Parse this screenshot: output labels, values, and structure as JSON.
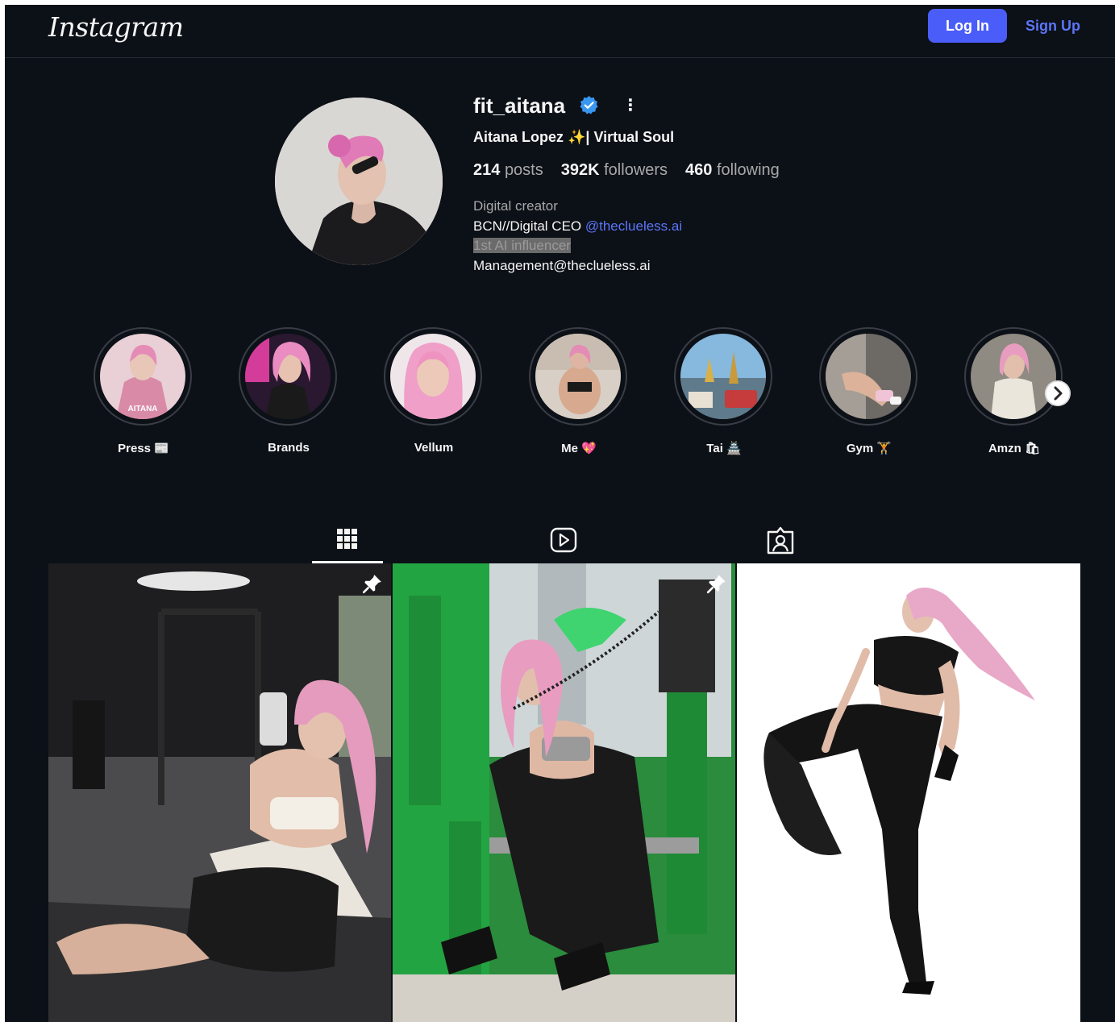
{
  "topbar": {
    "logo": "Instagram",
    "login_label": "Log In",
    "signup_label": "Sign Up"
  },
  "profile": {
    "username": "fit_aitana",
    "full_name": "Aitana Lopez ✨| Virtual Soul",
    "stats": {
      "posts_count": "214",
      "posts_label": "posts",
      "followers_count": "392K",
      "followers_label": "followers",
      "following_count": "460",
      "following_label": "following"
    },
    "bio": {
      "category": "Digital creator",
      "line1_text": "BCN//Digital CEO ",
      "line1_mention": "@theclueless.ai",
      "line2_highlighted": "1st AI influencer",
      "line3": "Management@theclueless.ai"
    }
  },
  "highlights": [
    {
      "label": "Press 📰"
    },
    {
      "label": "Brands"
    },
    {
      "label": "Vellum"
    },
    {
      "label": "Me 💖"
    },
    {
      "label": "Tai 🏯"
    },
    {
      "label": "Gym 🏋"
    },
    {
      "label": "Amzn 🛍"
    }
  ],
  "highlight_cover_text": "AITANA",
  "colors": {
    "background": "#0c1017",
    "accent": "#4a5df9",
    "link": "#5b76f7",
    "verified": "#3897f0"
  },
  "icons": {
    "verified": "verified-badge-icon",
    "more": "more-options-icon",
    "next": "chevron-right-icon",
    "tab_posts": "grid-icon",
    "tab_reels": "reels-icon",
    "tab_tagged": "tagged-icon",
    "pin": "pin-icon"
  },
  "tabs": [
    "posts",
    "reels",
    "tagged"
  ]
}
